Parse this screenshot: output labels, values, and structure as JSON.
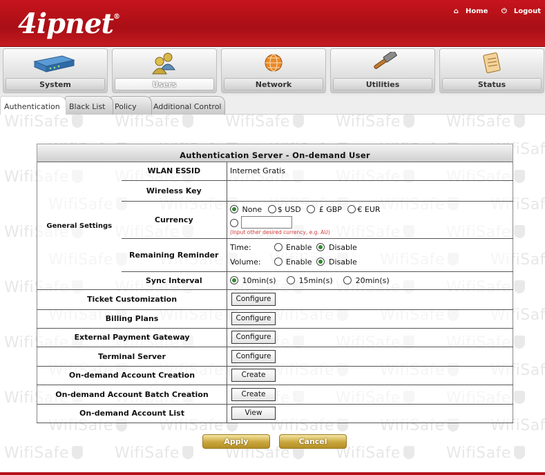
{
  "watermark": "WifiSafe",
  "header": {
    "logo": "4ipnet",
    "logo_mark": "®",
    "home_label": "Home",
    "logout_label": "Logout",
    "brand_color": "#b5121a"
  },
  "nav": {
    "items": [
      {
        "label": "System",
        "icon": "router-icon",
        "active": false
      },
      {
        "label": "Users",
        "icon": "users-icon",
        "active": true
      },
      {
        "label": "Network",
        "icon": "globe-icon",
        "active": false
      },
      {
        "label": "Utilities",
        "icon": "hammer-icon",
        "active": false
      },
      {
        "label": "Status",
        "icon": "document-icon",
        "active": false
      }
    ]
  },
  "subtabs": [
    {
      "label": "Authentication",
      "active": true
    },
    {
      "label": "Black List",
      "active": false
    },
    {
      "label": "Policy",
      "active": false
    },
    {
      "label": "Additional Control",
      "active": false
    }
  ],
  "panel": {
    "title": "Authentication Server - On-demand User",
    "general_settings_label": "General Settings",
    "wlan_essid_label": "WLAN ESSID",
    "wlan_essid_value": "Internet Gratis",
    "wireless_key_label": "Wireless Key",
    "wireless_key_value": "",
    "currency_label": "Currency",
    "currency_options": [
      {
        "label": "None",
        "checked": true
      },
      {
        "label": "$ USD",
        "checked": false
      },
      {
        "label": "£ GBP",
        "checked": false
      },
      {
        "label": "€ EUR",
        "checked": false
      }
    ],
    "currency_other_value": "",
    "currency_hint": "(Input other desired currency, e.g. AU)",
    "reminder_label": "Remaining Reminder",
    "reminder_time_label": "Time:",
    "reminder_volume_label": "Volume:",
    "enable_label": "Enable",
    "disable_label": "Disable",
    "sync_label": "Sync Interval",
    "sync_options": [
      {
        "label": "10min(s)",
        "checked": true
      },
      {
        "label": "15min(s)",
        "checked": false
      },
      {
        "label": "20min(s)",
        "checked": false
      }
    ],
    "rows": [
      {
        "label": "Ticket Customization",
        "button": "Configure"
      },
      {
        "label": "Billing Plans",
        "button": "Configure"
      },
      {
        "label": "External Payment Gateway",
        "button": "Configure"
      },
      {
        "label": "Terminal Server",
        "button": "Configure"
      },
      {
        "label": "On-demand Account Creation",
        "button": "Create"
      },
      {
        "label": "On-demand Account Batch Creation",
        "button": "Create"
      },
      {
        "label": "On-demand Account List",
        "button": "View"
      }
    ]
  },
  "actions": {
    "apply_label": "Apply",
    "cancel_label": "Cancel"
  }
}
